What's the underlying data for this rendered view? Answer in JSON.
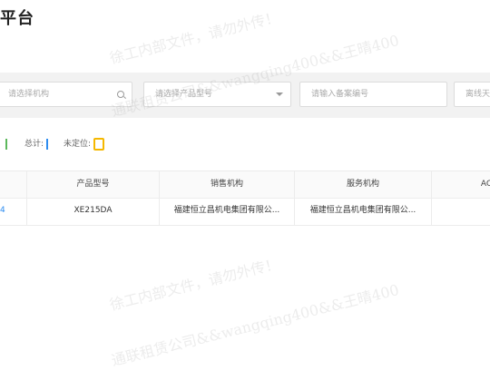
{
  "page": {
    "title": "平台"
  },
  "filters": {
    "org_placeholder": "请选择机构",
    "model_placeholder": "请选择产品型号",
    "contract_placeholder": "请输入备案编号",
    "extra_placeholder": "离线天"
  },
  "stats": {
    "first_value": "1",
    "total_label": "总计:",
    "total_value": "1",
    "unlocated_label": "未定位:",
    "unlocated_value": "0"
  },
  "table": {
    "headers": [
      "产品型号",
      "销售机构",
      "服务机构",
      "AC"
    ],
    "rows": [
      {
        "id_fragment": "4",
        "model": "XE215DA",
        "sales_org": "福建恒立昌机电集团有限公...",
        "service_org": "福建恒立昌机电集团有限公..."
      }
    ]
  },
  "watermark": {
    "line1": "徐工内部文件，请勿外传！",
    "line2": "通联租赁公司&&wangqing400&&王晴400"
  },
  "colors": {
    "accent": "#2d8cf0",
    "green": "#5cb85c",
    "blue": "#2d8cf0",
    "orange": "#f5b800"
  }
}
